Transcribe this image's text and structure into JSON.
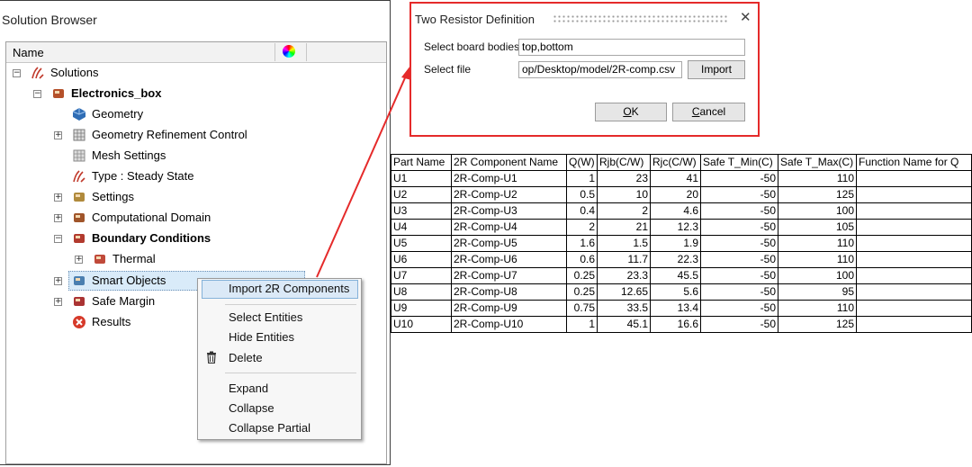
{
  "browser": {
    "title": "Solution Browser",
    "column_name": "Name",
    "tree": [
      {
        "label": "Solutions",
        "icon": "solutions-icon",
        "expander": "-",
        "bold": false
      },
      {
        "label": "Electronics_box",
        "icon": "model-icon",
        "expander": "-",
        "bold": true
      },
      {
        "label": "Geometry",
        "icon": "geometry-icon",
        "expander": "",
        "bold": false
      },
      {
        "label": "Geometry Refinement Control",
        "icon": "refinement-icon",
        "expander": "+",
        "bold": false
      },
      {
        "label": "Mesh Settings",
        "icon": "mesh-icon",
        "expander": "",
        "bold": false
      },
      {
        "label": "Type : Steady State",
        "icon": "type-icon",
        "expander": "",
        "bold": false
      },
      {
        "label": "Settings",
        "icon": "settings-icon",
        "expander": "+",
        "bold": false
      },
      {
        "label": "Computational Domain",
        "icon": "domain-icon",
        "expander": "+",
        "bold": false
      },
      {
        "label": "Boundary Conditions",
        "icon": "boundary-icon",
        "expander": "-",
        "bold": true
      },
      {
        "label": "Thermal",
        "icon": "thermal-icon",
        "expander": "+",
        "bold": false
      },
      {
        "label": "Smart Objects",
        "icon": "smart-objects-icon",
        "expander": "+",
        "bold": false
      },
      {
        "label": "Safe Margin",
        "icon": "safe-margin-icon",
        "expander": "+",
        "bold": false
      },
      {
        "label": "Results",
        "icon": "results-icon",
        "expander": "",
        "bold": false
      }
    ]
  },
  "context_menu": {
    "import": "Import 2R Components",
    "select_entities": "Select Entities",
    "hide_entities": "Hide Entities",
    "delete": "Delete",
    "expand": "Expand",
    "collapse": "Collapse",
    "collapse_partial": "Collapse Partial"
  },
  "dialog": {
    "title": "Two Resistor Definition",
    "board_label": "Select board bodies",
    "board_value": "top,bottom",
    "file_label": "Select file",
    "file_value": "op/Desktop/model/2R-comp.csv",
    "import_button": "Import",
    "ok_button": "OK",
    "cancel_button": "Cancel",
    "close_glyph": "✕"
  },
  "table": {
    "headers": [
      "Part Name",
      "2R Component Name",
      "Q(W)",
      "Rjb(C/W)",
      "Rjc(C/W)",
      "Safe T_Min(C)",
      "Safe T_Max(C)",
      "Function Name for Q"
    ],
    "rows": [
      [
        "U1",
        "2R-Comp-U1",
        "1",
        "23",
        "41",
        "-50",
        "110",
        ""
      ],
      [
        "U2",
        "2R-Comp-U2",
        "0.5",
        "10",
        "20",
        "-50",
        "125",
        ""
      ],
      [
        "U3",
        "2R-Comp-U3",
        "0.4",
        "2",
        "4.6",
        "-50",
        "100",
        ""
      ],
      [
        "U4",
        "2R-Comp-U4",
        "2",
        "21",
        "12.3",
        "-50",
        "105",
        ""
      ],
      [
        "U5",
        "2R-Comp-U5",
        "1.6",
        "1.5",
        "1.9",
        "-50",
        "110",
        ""
      ],
      [
        "U6",
        "2R-Comp-U6",
        "0.6",
        "11.7",
        "22.3",
        "-50",
        "110",
        ""
      ],
      [
        "U7",
        "2R-Comp-U7",
        "0.25",
        "23.3",
        "45.5",
        "-50",
        "100",
        ""
      ],
      [
        "U8",
        "2R-Comp-U8",
        "0.25",
        "12.65",
        "5.6",
        "-50",
        "95",
        ""
      ],
      [
        "U9",
        "2R-Comp-U9",
        "0.75",
        "33.5",
        "13.4",
        "-50",
        "110",
        ""
      ],
      [
        "U10",
        "2R-Comp-U10",
        "1",
        "45.1",
        "16.6",
        "-50",
        "125",
        ""
      ]
    ]
  },
  "colors": {
    "accent_red": "#e52a2a",
    "selection": "#d9ebf9"
  }
}
